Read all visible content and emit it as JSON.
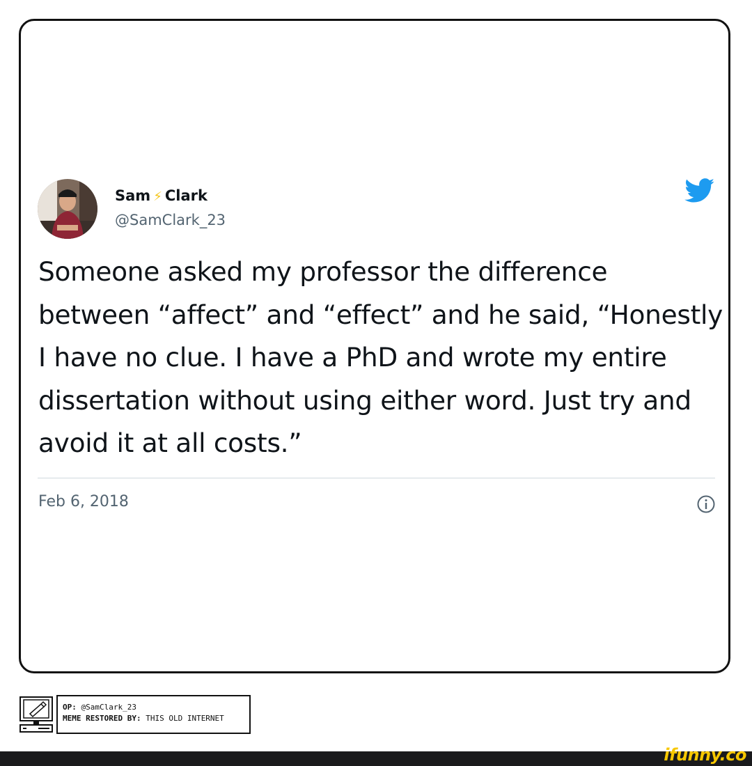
{
  "tweet": {
    "author_first": "Sam",
    "author_last": "Clark",
    "handle": "@SamClark_23",
    "text": "Someone asked my professor the difference between “affect” and “effect” and he said, “Honestly I have no clue. I have a PhD and wrote my entire dissertation without using either word. Just try and avoid it at all costs.”",
    "date": "Feb 6, 2018"
  },
  "credit": {
    "op_label": "OP:",
    "op_value": "@SamClark_23",
    "restored_label": "MEME RESTORED BY:",
    "restored_value": "THIS OLD INTERNET"
  },
  "watermark": {
    "text": "ifunny.co"
  },
  "colors": {
    "twitter_blue": "#1d9bf0",
    "bolt_yellow": "#f5c518",
    "watermark_yellow": "#f7c700"
  },
  "icons": [
    "twitter-bird-icon",
    "info-icon",
    "lightning-bolt-icon",
    "retro-computer-icon"
  ]
}
